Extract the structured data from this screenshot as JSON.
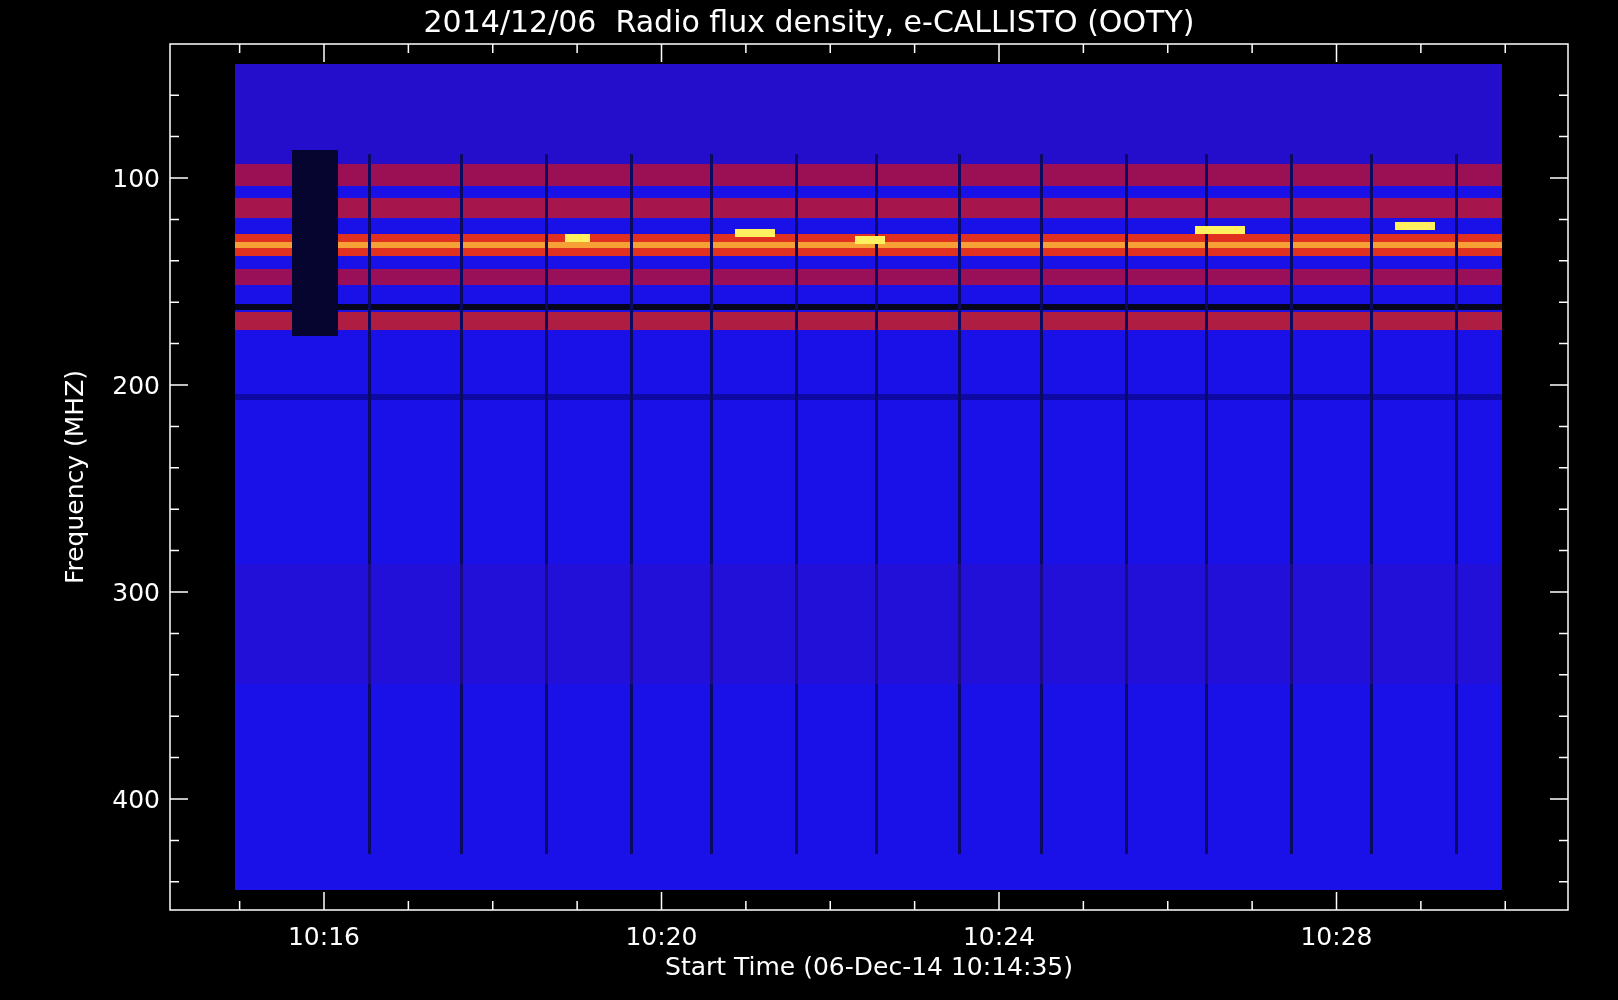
{
  "title": "2014/12/06  Radio flux density, e-CALLISTO (OOTY)",
  "y_axis": {
    "label": "Frequency (MHZ)",
    "ticks": [
      "100",
      "200",
      "300",
      "400"
    ]
  },
  "x_axis": {
    "label": "Start Time (06-Dec-14 10:14:35)",
    "ticks": [
      "10:16",
      "10:20",
      "10:24",
      "10:28"
    ]
  }
}
